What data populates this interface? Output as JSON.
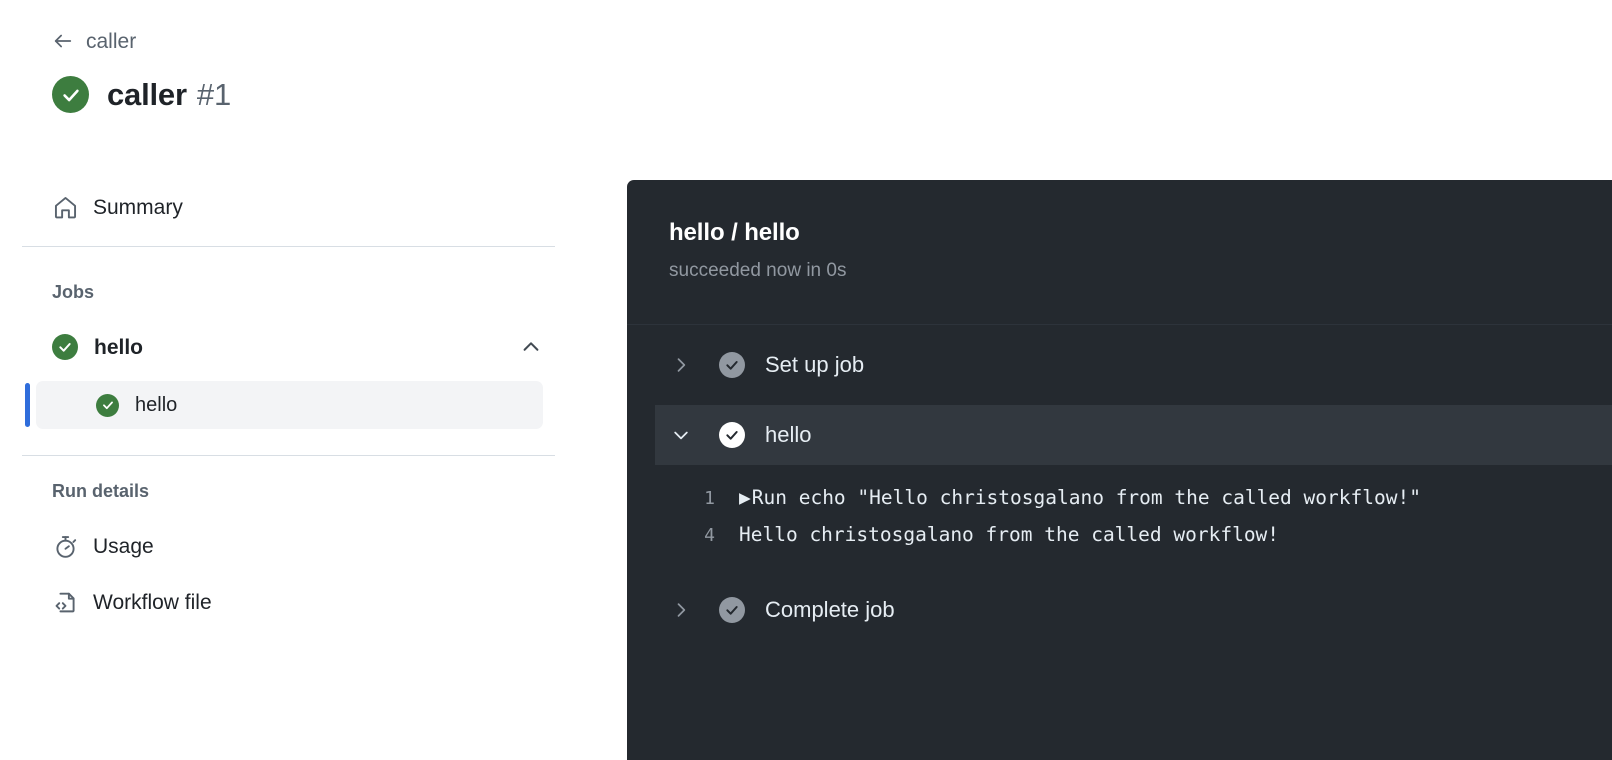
{
  "header": {
    "breadcrumb_label": "caller",
    "back_icon": "arrow-left-icon",
    "status_icon": "check-circle-icon",
    "title": "caller",
    "run_number": "#1"
  },
  "sidebar": {
    "summary": {
      "label": "Summary",
      "icon": "home-icon"
    },
    "jobs_label": "Jobs",
    "job": {
      "name": "hello",
      "status_icon": "check-circle-icon",
      "chevron": "chevron-up-icon",
      "steps": [
        {
          "label": "hello",
          "status_icon": "check-circle-icon",
          "selected": true
        }
      ]
    },
    "run_details_label": "Run details",
    "usage": {
      "label": "Usage",
      "icon": "stopwatch-icon"
    },
    "workflow_file": {
      "label": "Workflow file",
      "icon": "file-code-icon"
    }
  },
  "log_panel": {
    "title": "hello / hello",
    "subtitle": "succeeded now in 0s",
    "steps": [
      {
        "label": "Set up job",
        "twisty": "chevron-right-icon",
        "status_icon": "check-circle-icon",
        "expanded": false
      },
      {
        "label": "hello",
        "twisty": "chevron-down-icon",
        "status_icon": "check-circle-icon",
        "expanded": true
      },
      {
        "label": "Complete job",
        "twisty": "chevron-right-icon",
        "status_icon": "check-circle-icon",
        "expanded": false
      }
    ],
    "log_lines": [
      {
        "number": "1",
        "caret": "▶",
        "text": "Run echo \"Hello christosgalano from the called workflow!\""
      },
      {
        "number": "4",
        "caret": "",
        "text": "Hello christosgalano from the called workflow!"
      }
    ]
  },
  "colors": {
    "success_green": "#3d7d3f",
    "accent_blue": "#2f6ddb",
    "panel_bg": "#24292f",
    "panel_row_active": "#32383f",
    "sidebar_highlight": "#f3f4f6"
  }
}
